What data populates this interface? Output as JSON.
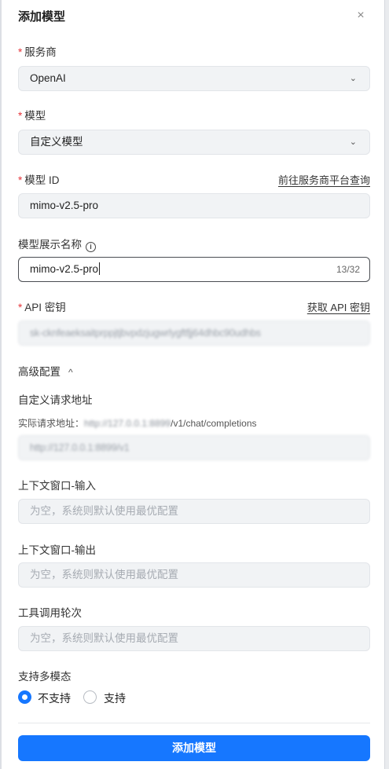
{
  "dialog": {
    "title": "添加模型",
    "close_glyph": "×"
  },
  "provider": {
    "label": "服务商",
    "value": "OpenAI",
    "chevron": "⌄"
  },
  "model": {
    "label": "模型",
    "value": "自定义模型",
    "chevron": "⌄"
  },
  "model_id": {
    "label": "模型 ID",
    "link": "前往服务商平台查询",
    "value": "mimo-v2.5-pro"
  },
  "display_name": {
    "label": "模型展示名称",
    "info_glyph": "i",
    "value": "mimo-v2.5-pro",
    "counter": "13/32"
  },
  "api_key": {
    "label": "API 密钥",
    "link": "获取 API 密钥",
    "value": "sk-cknfeaeksaitprppjtjbvpdzjugwrlygftfjj64dhbc90udhbs"
  },
  "advanced": {
    "label": "高级配置",
    "toggle_glyph": "^"
  },
  "custom_url": {
    "label": "自定义请求地址",
    "actual_prefix": "实际请求地址：",
    "actual_host": "http://127.0.0.1:8899",
    "actual_path": "/v1/chat/completions",
    "value": "http://127.0.0.1:8899/v1"
  },
  "context_input": {
    "label": "上下文窗口-输入",
    "placeholder": "为空，系统则默认使用最优配置"
  },
  "context_output": {
    "label": "上下文窗口-输出",
    "placeholder": "为空，系统则默认使用最优配置"
  },
  "tool_rounds": {
    "label": "工具调用轮次",
    "placeholder": "为空，系统则默认使用最优配置"
  },
  "multimodal": {
    "label": "支持多模态",
    "options": [
      "不支持",
      "支持"
    ],
    "selected": "不支持"
  },
  "submit": {
    "label": "添加模型"
  },
  "colors": {
    "primary": "#1677ff",
    "required": "#e5343a"
  }
}
